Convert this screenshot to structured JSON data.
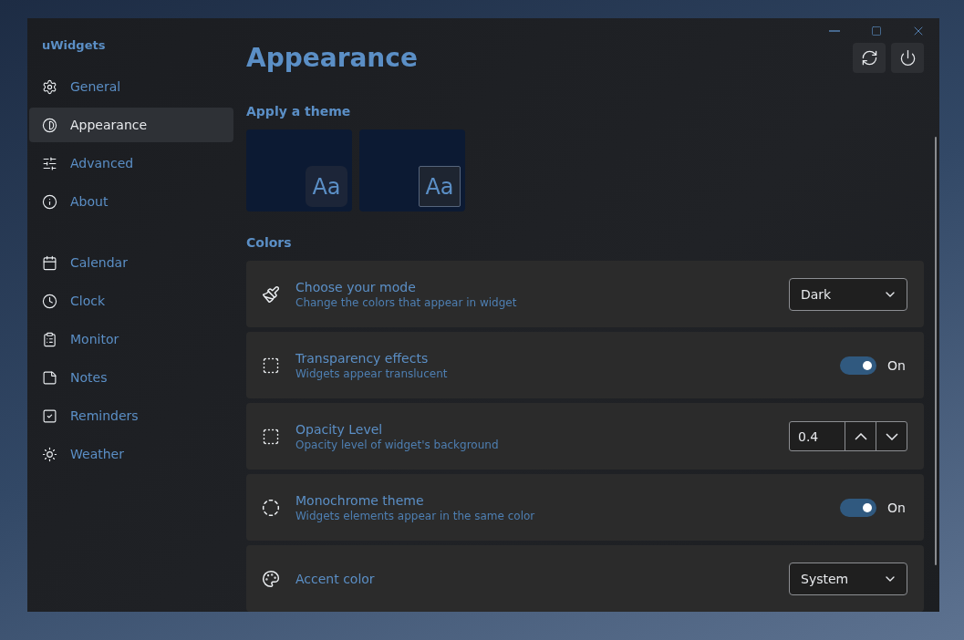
{
  "app": {
    "title": "uWidgets"
  },
  "nav_groups": [
    [
      {
        "label": "General",
        "selected": false
      },
      {
        "label": "Appearance",
        "selected": true
      },
      {
        "label": "Advanced",
        "selected": false
      },
      {
        "label": "About",
        "selected": false
      }
    ],
    [
      {
        "label": "Calendar",
        "selected": false
      },
      {
        "label": "Clock",
        "selected": false
      },
      {
        "label": "Monitor",
        "selected": false
      },
      {
        "label": "Notes",
        "selected": false
      },
      {
        "label": "Reminders",
        "selected": false
      },
      {
        "label": "Weather",
        "selected": false
      }
    ]
  ],
  "page": {
    "title": "Appearance"
  },
  "themes": {
    "heading": "Apply a theme",
    "items": [
      {
        "kind": "filled",
        "sample": "Aa"
      },
      {
        "kind": "outlined",
        "sample": "Aa"
      }
    ]
  },
  "colors": {
    "heading": "Colors",
    "settings": [
      {
        "kind": "dropdown",
        "title": "Choose your mode",
        "description": "Change the colors that appear in widget",
        "value": "Dark"
      },
      {
        "kind": "toggle",
        "title": "Transparency effects",
        "description": "Widgets appear translucent",
        "on": true,
        "state_label": "On"
      },
      {
        "kind": "number",
        "title": "Opacity Level",
        "description": "Opacity level of widget's background",
        "value": "0.4"
      },
      {
        "kind": "toggle",
        "title": "Monochrome theme",
        "description": "Widgets elements appear in the same color",
        "on": true,
        "state_label": "On"
      },
      {
        "kind": "dropdown",
        "title": "Accent color",
        "value": "System"
      }
    ]
  }
}
